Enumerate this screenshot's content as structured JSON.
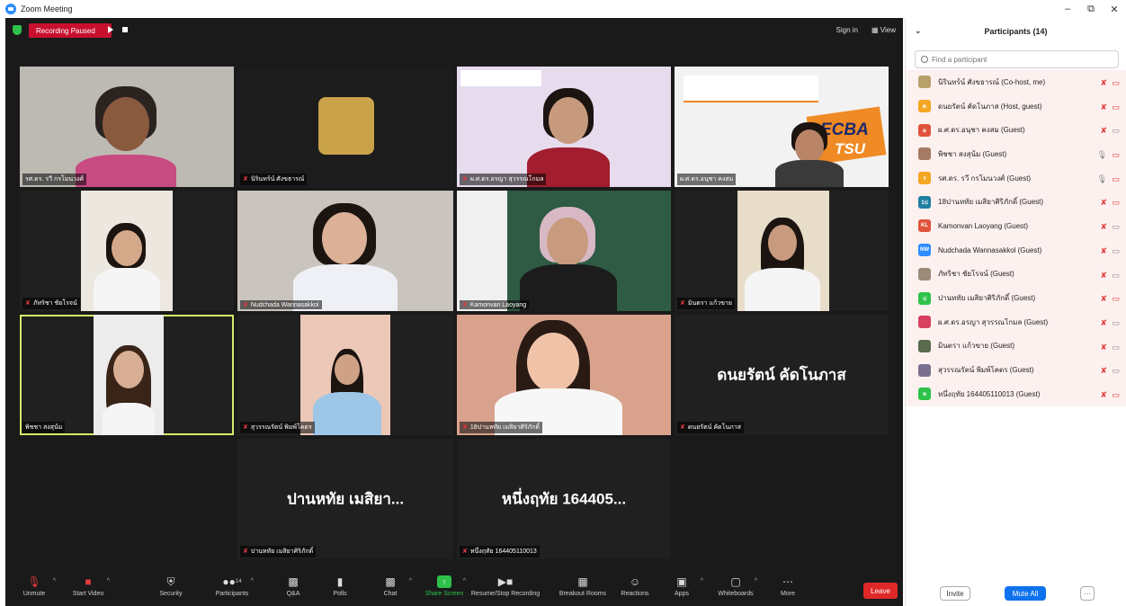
{
  "window": {
    "title": "Zoom Meeting"
  },
  "topbar": {
    "recording_label": "Recording Paused",
    "signin": "Sign in",
    "view": "▦ View"
  },
  "tiles": [
    {
      "name": "รศ.ดร. รวี กรโมนวงศ์"
    },
    {
      "name": "นิรินทร์น์ ศังขธารณ์"
    },
    {
      "name": "ผ.ศ.ดร.อรญา สุวรรณโกมล"
    },
    {
      "name": "ผ.ศ.ดร.อนุชา คงสม"
    },
    {
      "name": "ภัทริชา ชัยโรจน์"
    },
    {
      "name": "Nudchada Wannasakkol"
    },
    {
      "name": "Kamonvan Laoyang"
    },
    {
      "name": "มินตรา แก้วขาย"
    },
    {
      "name": "พิชชา สงสุน้ม"
    },
    {
      "name": "สุวรรณรัตน์ พิมพ์โคตร"
    },
    {
      "name": "18ปานหทัย เมสิยาศิริภักดิ์"
    },
    {
      "name": "ดนยรัตน์ คัดโนภาส",
      "big": "ดนยรัตน์ คัดโนภาส"
    },
    {
      "name": "ปานหทัย เมสิยาศิริภักดิ์",
      "big": "ปานหทัย เมสิยา..."
    },
    {
      "name": "หนึ่งฤทัย 164405110013",
      "big": "หนึ่งฤทัย 164405..."
    }
  ],
  "slides": {
    "ecba": "ECBA",
    "tsu": "TSU"
  },
  "toolbar": {
    "unmute": "Unmute",
    "start_video": "Start Video",
    "security": "Security",
    "participants": "Participants",
    "participants_count": "14",
    "qa": "Q&A",
    "polls": "Polls",
    "chat": "Chat",
    "share_screen": "Share Screen",
    "recording": "Resume/Stop Recording",
    "breakout": "Breakout Rooms",
    "reactions": "Reactions",
    "apps": "Apps",
    "whiteboards": "Whiteboards",
    "more": "More",
    "leave": "Leave"
  },
  "panel": {
    "title": "Participants (14)",
    "search_placeholder": "Find a participant",
    "participants": [
      {
        "name": "นิรินทร์น์ ศังขธารณ์ (Co-host, me)",
        "initials": "",
        "color": "#b8a06a"
      },
      {
        "name": "ดนยรัตน์ คัดโนภาส (Host, guest)",
        "initials": "ด",
        "color": "#f5a623"
      },
      {
        "name": "ผ.ศ.ดร.อนุชา คงสม (Guest)",
        "initials": "ผ",
        "color": "#e0543b"
      },
      {
        "name": "พิชชา สงสุน้ม (Guest)",
        "initials": "",
        "color": "#a57b64"
      },
      {
        "name": "รศ.ดร. รวี กรโมนวงศ์ (Guest)",
        "initials": "ร",
        "color": "#f5a623"
      },
      {
        "name": "18ปานหทัย เมสิยาศิริภักดิ์ (Guest)",
        "initials": "1ป",
        "color": "#1f7fa0"
      },
      {
        "name": "Kamonvan Laoyang (Guest)",
        "initials": "KL",
        "color": "#e0543b"
      },
      {
        "name": "Nudchada Wannasakkol (Guest)",
        "initials": "NW",
        "color": "#2d8cff"
      },
      {
        "name": "ภัทริชา ชัยโรจน์ (Guest)",
        "initials": "",
        "color": "#9c8b7a"
      },
      {
        "name": "ปานหทัย เมสิยาศิริภักดิ์ (Guest)",
        "initials": "ป",
        "color": "#2ec24a"
      },
      {
        "name": "ผ.ศ.ดร.อรญา สุวรรณโกมล (Guest)",
        "initials": "",
        "color": "#d84060"
      },
      {
        "name": "มินตรา แก้วขาย (Guest)",
        "initials": "",
        "color": "#5a6b4f"
      },
      {
        "name": "สุวรรณรัตน์ พิมพ์โคตร (Guest)",
        "initials": "",
        "color": "#7b6f8f"
      },
      {
        "name": "หนึ่งฤทัย 164405110013 (Guest)",
        "initials": "ห",
        "color": "#2ec24a"
      }
    ],
    "invite": "Invite",
    "mute_all": "Mute All",
    "more": "···"
  }
}
